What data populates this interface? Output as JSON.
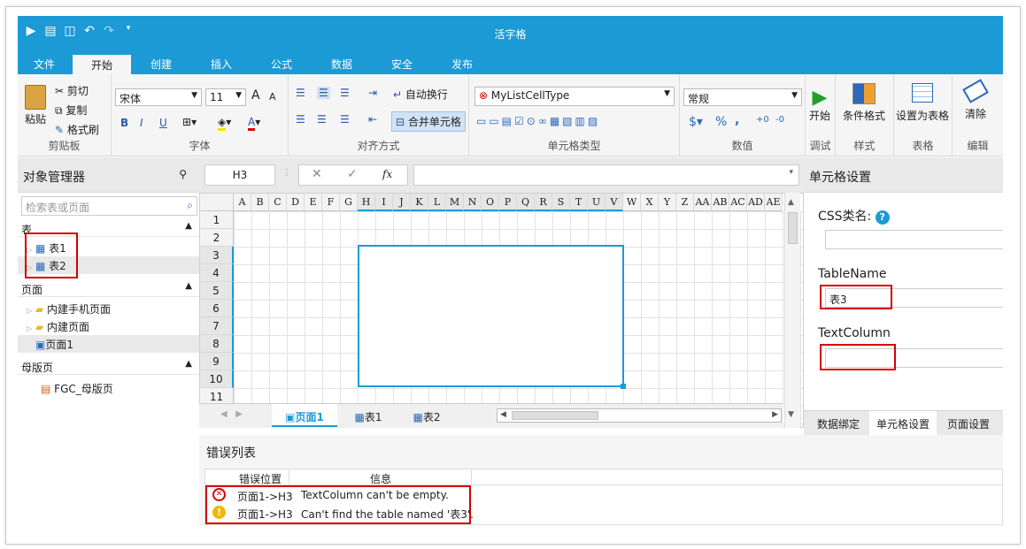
{
  "app": {
    "title": "活字格"
  },
  "menu_tabs": [
    "文件",
    "开始",
    "创建",
    "插入",
    "公式",
    "数据",
    "安全",
    "发布"
  ],
  "ribbon": {
    "clipboard": {
      "paste": "粘贴",
      "cut": "剪切",
      "copy": "复制",
      "format_painter": "格式刷",
      "label": "剪贴板"
    },
    "font": {
      "family": "宋体",
      "size": "11",
      "bold": "B",
      "italic": "I",
      "underline": "U",
      "grow": "A",
      "shrink": "A",
      "label": "字体"
    },
    "align": {
      "wrap": "自动换行",
      "merge": "合并单元格",
      "label": "对齐方式"
    },
    "celltype": {
      "value": "MyListCellType",
      "label": "单元格类型"
    },
    "number": {
      "format": "常规",
      "currency": "$",
      "percent": "%",
      "comma": ",",
      "label": "数值"
    },
    "debug": {
      "start": "开始",
      "label": "调试"
    },
    "style": {
      "cond": "条件格式",
      "label": "样式"
    },
    "table": {
      "set": "设置为表格",
      "label": "表格"
    },
    "edit": {
      "clear": "清除",
      "label": "编辑"
    }
  },
  "object_manager": {
    "title": "对象管理器",
    "search_placeholder": "检索表或页面",
    "tables_header": "表",
    "tables": [
      "表1",
      "表2"
    ],
    "pages_header": "页面",
    "page_folders": [
      "内建手机页面",
      "内建页面"
    ],
    "pages": [
      "页面1"
    ],
    "master_header": "母版页",
    "masters": [
      "FGC_母版页"
    ]
  },
  "formula_bar": {
    "cell_ref": "H3",
    "fx": "fx",
    "cancel": "✕",
    "confirm": "✓"
  },
  "grid": {
    "columns": [
      "A",
      "B",
      "C",
      "D",
      "E",
      "F",
      "G",
      "H",
      "I",
      "J",
      "K",
      "L",
      "M",
      "N",
      "O",
      "P",
      "Q",
      "R",
      "S",
      "T",
      "U",
      "V",
      "W",
      "X",
      "Y",
      "Z",
      "AA",
      "AB",
      "AC",
      "AD",
      "AE"
    ],
    "rows": [
      "1",
      "2",
      "3",
      "4",
      "5",
      "6",
      "7",
      "8",
      "9",
      "10",
      "11"
    ]
  },
  "sheet_tabs": [
    "页面1",
    "表1",
    "表2"
  ],
  "cell_settings": {
    "title": "单元格设置",
    "css_label": "CSS类名:",
    "css_value": "",
    "table_name_label": "TableName",
    "table_name_value": "表3",
    "text_column_label": "TextColumn",
    "text_column_value": "",
    "bottom_tabs": [
      "数据绑定",
      "单元格设置",
      "页面设置"
    ]
  },
  "errors": {
    "title": "错误列表",
    "col_location": "错误位置",
    "col_info": "信息",
    "rows": [
      {
        "type": "error",
        "location": "页面1->H3",
        "message": "TextColumn can't be empty."
      },
      {
        "type": "warning",
        "location": "页面1->H3",
        "message": "Can't find the table named '表3'."
      }
    ]
  },
  "colors": {
    "accent": "#1b9ad6",
    "highlight": "#d40000",
    "selection": "#1b9ad6"
  }
}
